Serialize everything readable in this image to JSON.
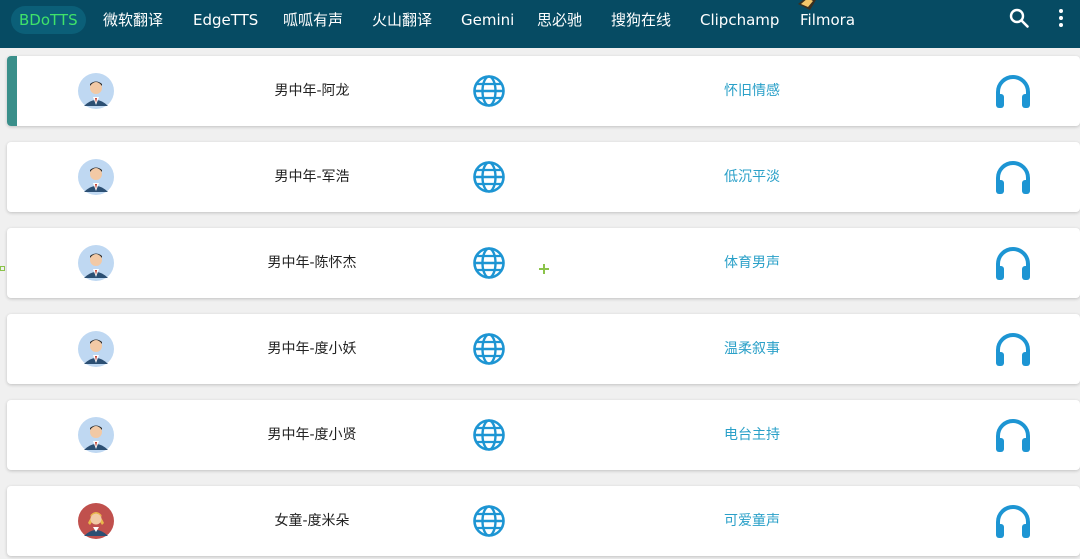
{
  "tabs": [
    {
      "label": "BDoTTS",
      "active": true
    },
    {
      "label": "微软翻译",
      "active": false
    },
    {
      "label": "EdgeTTS",
      "active": false
    },
    {
      "label": "呱呱有声",
      "active": false
    },
    {
      "label": "火山翻译",
      "active": false
    },
    {
      "label": "Gemini",
      "active": false
    },
    {
      "label": "思必驰",
      "active": false
    },
    {
      "label": "搜狗在线",
      "active": false
    },
    {
      "label": "Clipchamp",
      "active": false
    },
    {
      "label": "Filmora",
      "active": false
    }
  ],
  "toolbar": {
    "search_icon": "search-icon",
    "more_icon": "more-vert-icon"
  },
  "voices": [
    {
      "name": "男中年-阿龙",
      "style": "怀旧情感",
      "avatar": "male-avatar-icon",
      "selected": true
    },
    {
      "name": "男中年-军浩",
      "style": "低沉平淡",
      "avatar": "male-avatar-icon",
      "selected": false
    },
    {
      "name": "男中年-陈怀杰",
      "style": "体育男声",
      "avatar": "male-avatar-icon",
      "selected": false
    },
    {
      "name": "男中年-度小妖",
      "style": "温柔叙事",
      "avatar": "male-avatar-icon",
      "selected": false
    },
    {
      "name": "男中年-度小贤",
      "style": "电台主持",
      "avatar": "male-avatar-icon",
      "selected": false
    },
    {
      "name": "女童-度米朵",
      "style": "可爱童声",
      "avatar": "female-avatar-icon",
      "selected": false
    }
  ],
  "colors": {
    "topbar": "#064b63",
    "active_tab_text": "#3fe26a",
    "accent_blue": "#1d95d3",
    "selected_marker": "#3a8f8a"
  }
}
